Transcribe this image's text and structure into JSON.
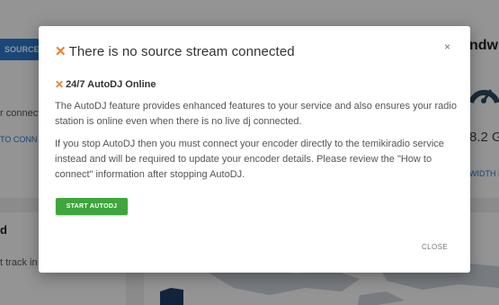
{
  "background": {
    "source_button": "SOURCE:",
    "left_text": "r connect",
    "left_link": "TO CONN",
    "right_title": "ndwi",
    "right_value": "8.2 G",
    "right_link": "WIDTH H",
    "bottom_title": "d",
    "bottom_text": "t track in"
  },
  "modal": {
    "title": "There is no source stream connected",
    "close_symbol": "×",
    "section_title": "24/7 AutoDJ Online",
    "paragraph1": "The AutoDJ feature provides enhanced features to your service and also ensures your radio station is online even when there is no live dj connected.",
    "paragraph2": "If you stop AutoDJ then you must connect your encoder directly to the temikiradio service instead and will be required to update your encoder details. Please review the \"How to connect\" information after stopping AutoDJ.",
    "start_button": "START AUTODJ",
    "close_button": "CLOSE"
  },
  "colors": {
    "accent_orange": "#f07c1d",
    "button_green": "#3ea63c",
    "link_blue": "#2d7bd3"
  }
}
